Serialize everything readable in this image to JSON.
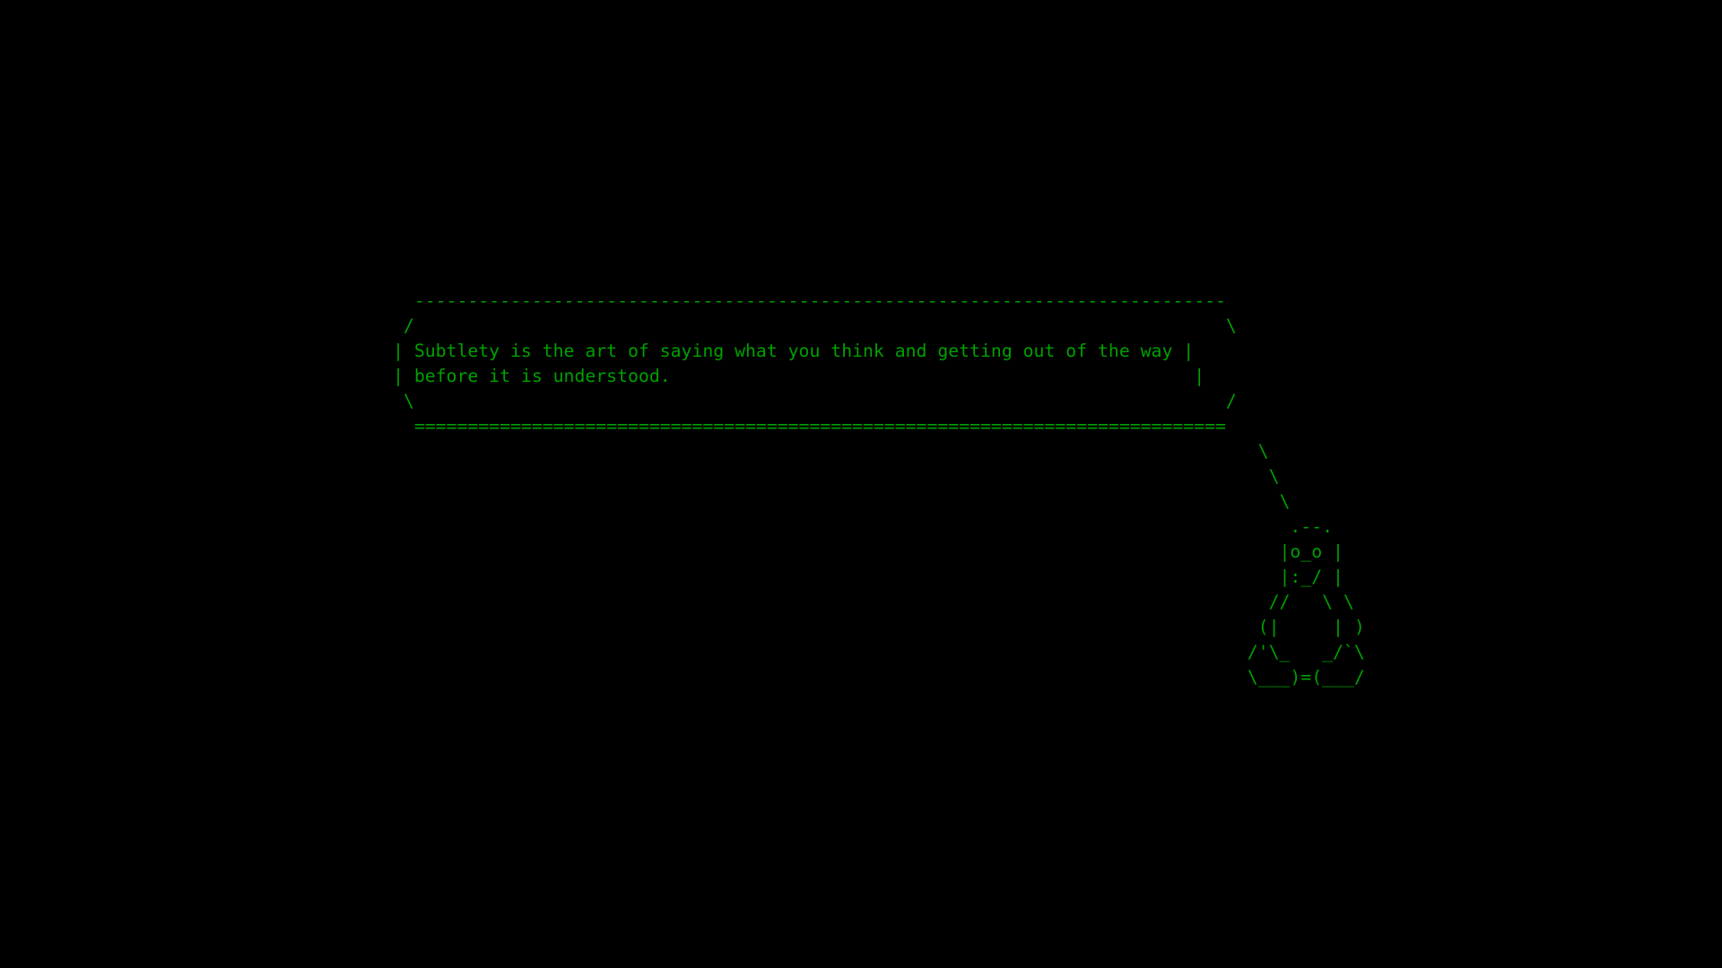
{
  "terminal": {
    "text_color": "#00a000",
    "background_color": "#000000",
    "lines": [
      "  ----------------------------------------------------------------------------",
      " /                                                                            \\",
      "| Subtlety is the art of saying what you think and getting out of the way |",
      "| before it is understood.                                                 |",
      " \\                                                                            /",
      "  ============================================================================",
      "                                                                                 \\",
      "                                                                                  \\",
      "                                                                                   \\",
      "                                                                                    .--.",
      "                                                                                   |o_o |",
      "                                                                                   |:_/ |",
      "                                                                                  //   \\ \\",
      "                                                                                 (|     | )",
      "                                                                                /'\\_   _/`\\",
      "                                                                                \\___)=(___/"
    ]
  }
}
